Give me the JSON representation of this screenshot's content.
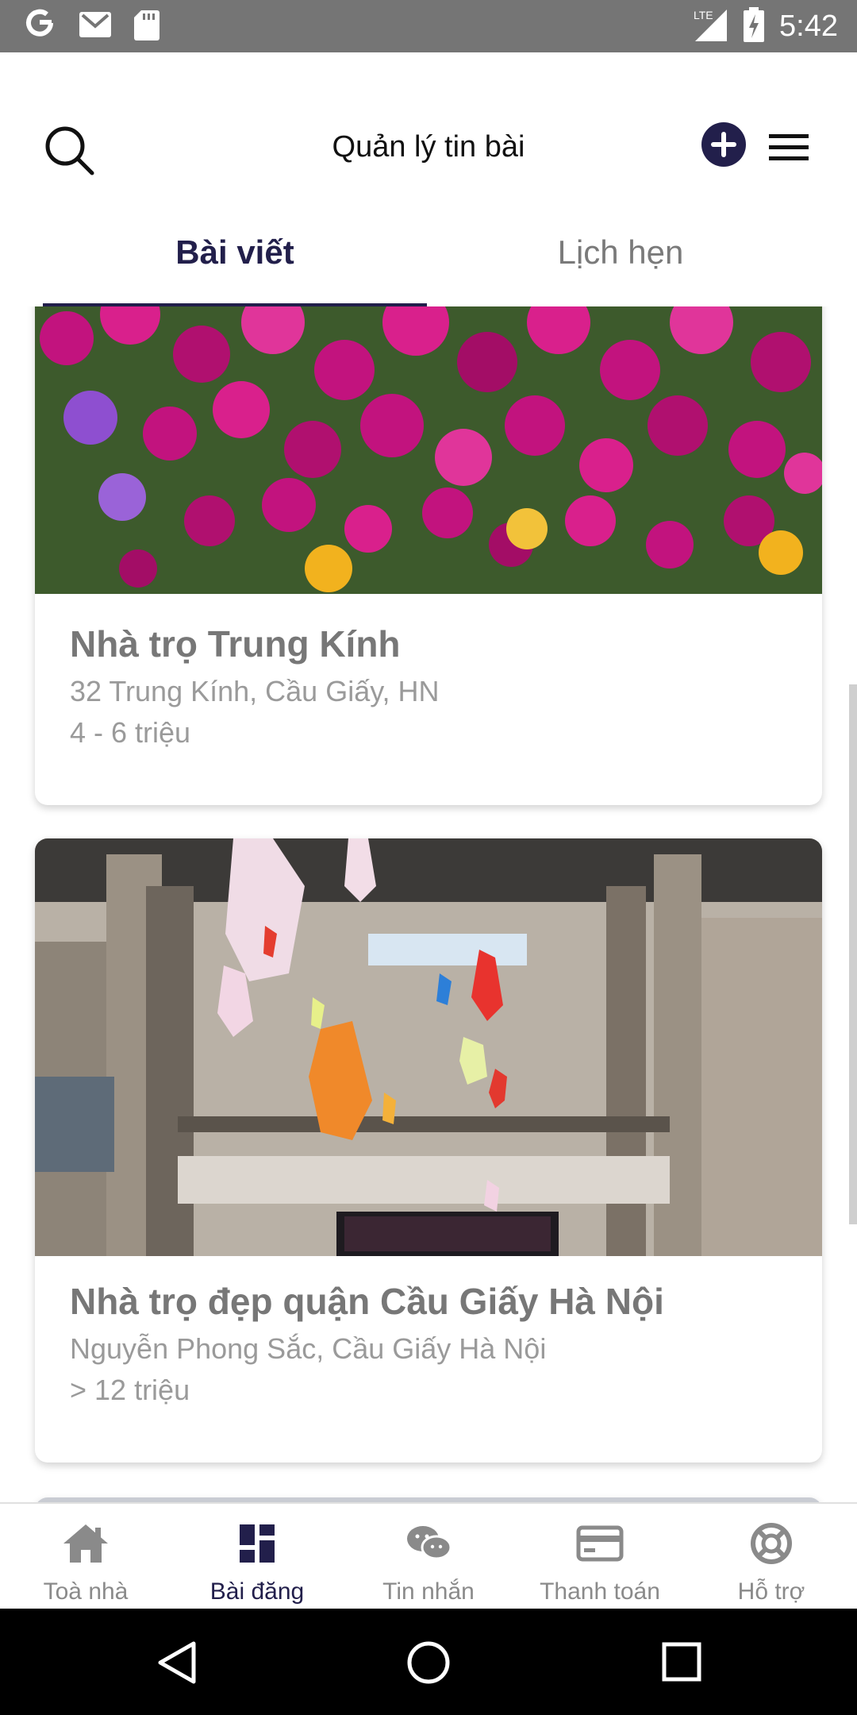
{
  "status_bar": {
    "time": "5:42",
    "network": "LTE",
    "left_icons": [
      "google-icon",
      "gmail-icon",
      "sd-card-icon"
    ],
    "right_icons": [
      "lte-signal-icon",
      "battery-charging-icon"
    ]
  },
  "header": {
    "title": "Quản lý tin bài",
    "accent_color": "#221f4b"
  },
  "tabs": [
    {
      "label": "Bài viết",
      "active": true
    },
    {
      "label": "Lịch hẹn",
      "active": false
    }
  ],
  "listings": [
    {
      "title": "Nhà trọ Trung Kính",
      "address": "32 Trung Kính, Cầu Giấy, HN",
      "price": "4 - 6 triệu",
      "image": "flowers-photo"
    },
    {
      "title": "Nhà trọ đẹp quận Cầu  Giấy Hà Nội",
      "address": "Nguyễn Phong Sắc, Cầu Giấy Hà Nội",
      "price": "> 12 triệu",
      "image": "mall-interior-photo"
    }
  ],
  "bottom_nav": [
    {
      "label": "Toà nhà",
      "icon": "home-icon",
      "active": false
    },
    {
      "label": "Bài đăng",
      "icon": "dashboard-icon",
      "active": true
    },
    {
      "label": "Tin nhắn",
      "icon": "chat-icon",
      "active": false
    },
    {
      "label": "Thanh toán",
      "icon": "credit-card-icon",
      "active": false
    },
    {
      "label": "Hỗ trợ",
      "icon": "lifebuoy-icon",
      "active": false
    }
  ]
}
